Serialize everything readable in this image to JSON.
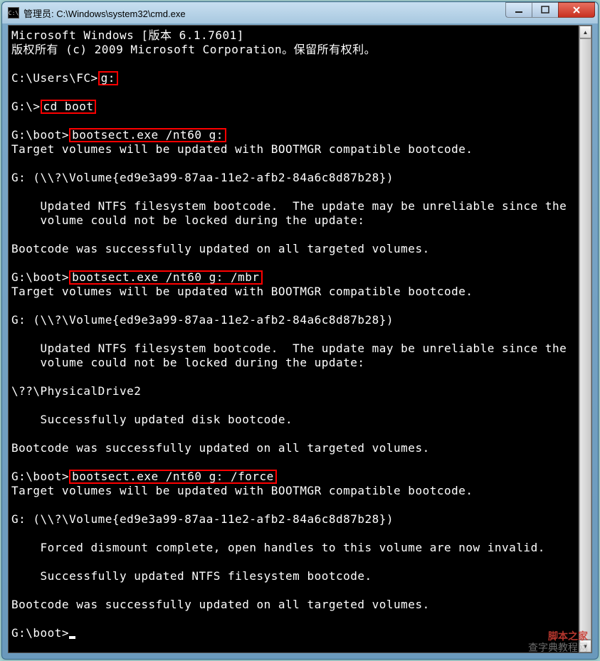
{
  "window": {
    "title": "管理员: C:\\Windows\\system32\\cmd.exe",
    "icon_label": "C:\\"
  },
  "terminal": {
    "header1": "Microsoft Windows [版本 6.1.7601]",
    "header2": "版权所有 (c) 2009 Microsoft Corporation。保留所有权利。",
    "prompt1_pre": "C:\\Users\\FC>",
    "cmd1": "g:",
    "prompt2_pre": "G:\\>",
    "cmd2": "cd boot",
    "prompt3_pre": "G:\\boot>",
    "cmd3": "bootsect.exe /nt60 g:",
    "out_target": "Target volumes will be updated with BOOTMGR compatible bootcode.",
    "out_volume": "G: (\\\\?\\Volume{ed9e3a99-87aa-11e2-afb2-84a6c8d87b28})",
    "out_updated1": "    Updated NTFS filesystem bootcode.  The update may be unreliable since the",
    "out_updated2": "    volume could not be locked during the update:",
    "out_success": "Bootcode was successfully updated on all targeted volumes.",
    "cmd4": "bootsect.exe /nt60 g: /mbr",
    "out_phys": "\\??\\PhysicalDrive2",
    "out_disk_success": "    Successfully updated disk bootcode.",
    "cmd5": "bootsect.exe /nt60 g: /force",
    "out_forced": "    Forced dismount complete, open handles to this volume are now invalid.",
    "out_ntfs_success": "    Successfully updated NTFS filesystem bootcode.",
    "final_prompt": "G:\\boot>"
  },
  "watermark": {
    "line1": "脚本之家",
    "line2": "查字典教程网"
  }
}
